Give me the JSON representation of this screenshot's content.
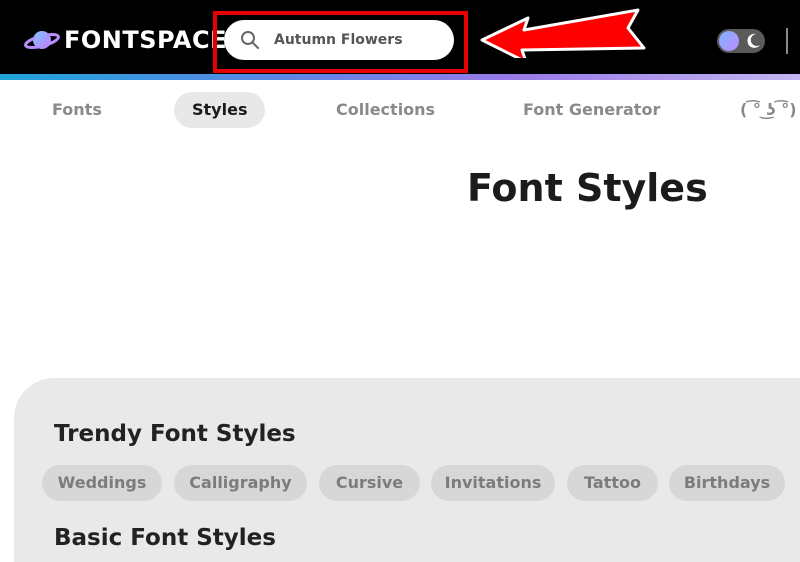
{
  "header": {
    "brand": "FONTSPACE",
    "search": {
      "value": "Autumn Flowers",
      "placeholder": "Search"
    },
    "colors": {
      "background": "#000000",
      "highlight": "#e60000",
      "arrow": "#ff0000"
    }
  },
  "nav": {
    "items": [
      {
        "label": "Fonts",
        "active": false
      },
      {
        "label": "Styles",
        "active": true
      },
      {
        "label": "Collections",
        "active": false
      },
      {
        "label": "Font Generator",
        "active": false
      },
      {
        "label": "( ͡° ͜ʖ ͡°)",
        "active": false
      }
    ]
  },
  "main": {
    "title": "Font Styles",
    "sections": [
      {
        "heading": "Trendy Font Styles",
        "chips": [
          "Weddings",
          "Calligraphy",
          "Cursive",
          "Invitations",
          "Tattoo",
          "Birthdays"
        ]
      },
      {
        "heading": "Basic Font Styles",
        "chips": []
      }
    ]
  },
  "icons": {
    "logo": "planet-icon",
    "search": "search-icon",
    "theme": "moon-icon",
    "annotation": "arrow-icon"
  }
}
